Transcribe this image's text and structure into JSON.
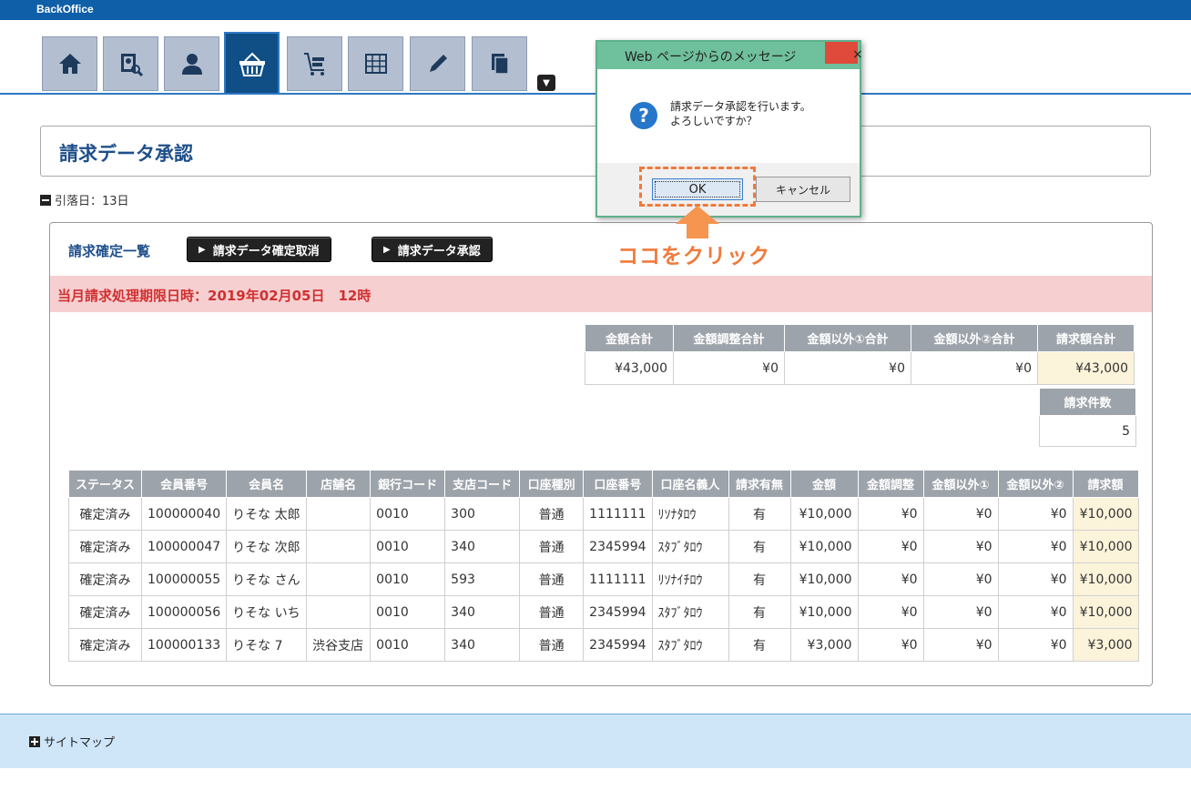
{
  "app": {
    "brand": "BackOffice"
  },
  "nav": {
    "icons": [
      "home-icon",
      "search-user-icon",
      "user-icon",
      "basket-icon",
      "cart-icon",
      "grid-icon",
      "pencil-icon",
      "copy-icon"
    ],
    "more": "▼"
  },
  "page": {
    "title": "請求データ承認",
    "withdrawal_day": "引落日：13日"
  },
  "list": {
    "heading": "請求確定一覧",
    "btn_cancel": "請求データ確定取消",
    "btn_approve": "請求データ承認",
    "deadline": "当月請求処理期限日時：2019年02月05日　12時"
  },
  "summary": {
    "headers": [
      "金額合計",
      "金額調整合計",
      "金額以外①合計",
      "金額以外②合計",
      "請求額合計"
    ],
    "values": [
      "¥43,000",
      "¥0",
      "¥0",
      "¥0",
      "¥43,000"
    ],
    "count_header": "請求件数",
    "count_value": "5"
  },
  "table": {
    "headers": [
      "ステータス",
      "会員番号",
      "会員名",
      "店舗名",
      "銀行コード",
      "支店コード",
      "口座種別",
      "口座番号",
      "口座名義人",
      "請求有無",
      "金額",
      "金額調整",
      "金額以外①",
      "金額以外②",
      "請求額"
    ],
    "rows": [
      [
        "確定済み",
        "100000040",
        "りそな 太郎",
        "",
        "0010",
        "300",
        "普通",
        "1111111",
        "ﾘｿﾅﾀﾛｳ",
        "有",
        "¥10,000",
        "¥0",
        "¥0",
        "¥0",
        "¥10,000"
      ],
      [
        "確定済み",
        "100000047",
        "りそな 次郎",
        "",
        "0010",
        "340",
        "普通",
        "2345994",
        "ｽﾀﾌﾞﾀﾛｳ",
        "有",
        "¥10,000",
        "¥0",
        "¥0",
        "¥0",
        "¥10,000"
      ],
      [
        "確定済み",
        "100000055",
        "りそな さん",
        "",
        "0010",
        "593",
        "普通",
        "1111111",
        "ﾘｿﾅｲﾁﾛｳ",
        "有",
        "¥10,000",
        "¥0",
        "¥0",
        "¥0",
        "¥10,000"
      ],
      [
        "確定済み",
        "100000056",
        "りそな いち",
        "",
        "0010",
        "340",
        "普通",
        "2345994",
        "ｽﾀﾌﾞﾀﾛｳ",
        "有",
        "¥10,000",
        "¥0",
        "¥0",
        "¥0",
        "¥10,000"
      ],
      [
        "確定済み",
        "100000133",
        "りそな 7",
        "渋谷支店",
        "0010",
        "340",
        "普通",
        "2345994",
        "ｽﾀﾌﾞﾀﾛｳ",
        "有",
        "¥3,000",
        "¥0",
        "¥0",
        "¥0",
        "¥3,000"
      ]
    ]
  },
  "footer": {
    "sitemap": "サイトマップ"
  },
  "dialog": {
    "title": "Web ページからのメッセージ",
    "close": "×",
    "line1": "請求データ承認を行います。",
    "line2": "よろしいですか？",
    "ok": "OK",
    "cancel": "キャンセル",
    "question_mark": "?"
  },
  "annotation": {
    "text": "ココをクリック",
    "color": "#f07a3c"
  },
  "colors": {
    "topbar": "#0f5fa8",
    "deadline_bg": "#f6cfd1",
    "deadline_text": "#d03030",
    "sitemap_bg": "#cfe6f8"
  }
}
